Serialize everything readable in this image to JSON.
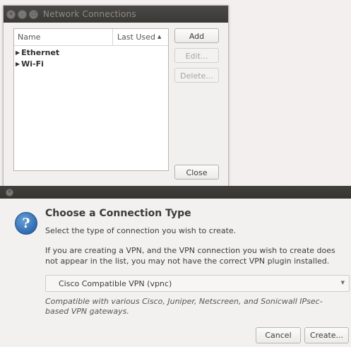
{
  "network_window": {
    "title": "Network Connections",
    "columns": {
      "name": "Name",
      "last_used": "Last Used"
    },
    "groups": [
      {
        "label": "Ethernet"
      },
      {
        "label": "Wi-Fi"
      }
    ],
    "buttons": {
      "add": "Add",
      "edit": "Edit...",
      "delete": "Delete...",
      "close": "Close"
    }
  },
  "dialog": {
    "heading": "Choose a Connection Type",
    "subtitle": "Select the type of connection you wish to create.",
    "info": "If you are creating a VPN, and the VPN connection you wish to create does not appear in the list, you may not have the correct VPN plugin installed.",
    "selected_type": "Cisco Compatible VPN (vpnc)",
    "description": "Compatible with various Cisco, Juniper, Netscreen, and Sonicwall IPsec-based VPN gateways.",
    "buttons": {
      "cancel": "Cancel",
      "create": "Create..."
    }
  },
  "icons": {
    "question": "question-icon",
    "expander": "triangle-right-icon",
    "sort": "sort-ascending-icon",
    "dropdown": "chevron-down-icon"
  },
  "colors": {
    "titlebar": "#3a3936",
    "question_icon": "#2f6bb0",
    "window_bg": "#f1f0ee"
  }
}
